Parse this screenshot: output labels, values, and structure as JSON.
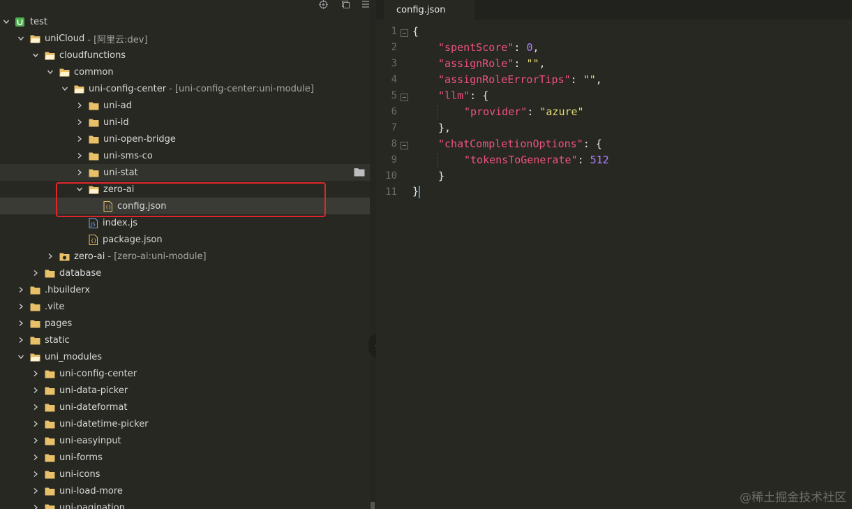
{
  "sidebar": {
    "toolbar": {
      "target_icon": "crosshair-icon",
      "collapse_icon": "collapse-all-icon",
      "menu_icon": "menu-icon"
    },
    "tree": [
      {
        "label": "test",
        "suffix": "",
        "depth": 0,
        "chevron": "down",
        "icon": "project-badge"
      },
      {
        "label": "uniCloud",
        "suffix": "[阿里云:dev]",
        "depth": 1,
        "chevron": "down",
        "icon": "folder-open"
      },
      {
        "label": "cloudfunctions",
        "suffix": "",
        "depth": 2,
        "chevron": "down",
        "icon": "folder-open"
      },
      {
        "label": "common",
        "suffix": "",
        "depth": 3,
        "chevron": "down",
        "icon": "folder-open"
      },
      {
        "label": "uni-config-center",
        "suffix": "[uni-config-center:uni-module]",
        "depth": 4,
        "chevron": "down",
        "icon": "folder-open"
      },
      {
        "label": "uni-ad",
        "suffix": "",
        "depth": 5,
        "chevron": "right",
        "icon": "folder"
      },
      {
        "label": "uni-id",
        "suffix": "",
        "depth": 5,
        "chevron": "right",
        "icon": "folder"
      },
      {
        "label": "uni-open-bridge",
        "suffix": "",
        "depth": 5,
        "chevron": "right",
        "icon": "folder"
      },
      {
        "label": "uni-sms-co",
        "suffix": "",
        "depth": 5,
        "chevron": "right",
        "icon": "folder"
      },
      {
        "label": "uni-stat",
        "suffix": "",
        "depth": 5,
        "chevron": "right",
        "icon": "folder"
      },
      {
        "label": "zero-ai",
        "suffix": "",
        "depth": 5,
        "chevron": "down",
        "icon": "folder-open"
      },
      {
        "label": "config.json",
        "suffix": "",
        "depth": 6,
        "chevron": "none",
        "icon": "json-file"
      },
      {
        "label": "index.js",
        "suffix": "",
        "depth": 5,
        "chevron": "none",
        "icon": "js-file"
      },
      {
        "label": "package.json",
        "suffix": "",
        "depth": 5,
        "chevron": "none",
        "icon": "json-file"
      },
      {
        "label": "zero-ai",
        "suffix": "[zero-ai:uni-module]",
        "depth": 3,
        "chevron": "right",
        "icon": "cloud-folder"
      },
      {
        "label": "database",
        "suffix": "",
        "depth": 2,
        "chevron": "right",
        "icon": "folder"
      },
      {
        "label": ".hbuilderx",
        "suffix": "",
        "depth": 1,
        "chevron": "right",
        "icon": "folder"
      },
      {
        "label": ".vite",
        "suffix": "",
        "depth": 1,
        "chevron": "right",
        "icon": "folder"
      },
      {
        "label": "pages",
        "suffix": "",
        "depth": 1,
        "chevron": "right",
        "icon": "folder"
      },
      {
        "label": "static",
        "suffix": "",
        "depth": 1,
        "chevron": "right",
        "icon": "folder"
      },
      {
        "label": "uni_modules",
        "suffix": "",
        "depth": 1,
        "chevron": "down",
        "icon": "folder-open"
      },
      {
        "label": "uni-config-center",
        "suffix": "",
        "depth": 2,
        "chevron": "right",
        "icon": "folder"
      },
      {
        "label": "uni-data-picker",
        "suffix": "",
        "depth": 2,
        "chevron": "right",
        "icon": "folder"
      },
      {
        "label": "uni-dateformat",
        "suffix": "",
        "depth": 2,
        "chevron": "right",
        "icon": "folder"
      },
      {
        "label": "uni-datetime-picker",
        "suffix": "",
        "depth": 2,
        "chevron": "right",
        "icon": "folder"
      },
      {
        "label": "uni-easyinput",
        "suffix": "",
        "depth": 2,
        "chevron": "right",
        "icon": "folder"
      },
      {
        "label": "uni-forms",
        "suffix": "",
        "depth": 2,
        "chevron": "right",
        "icon": "folder"
      },
      {
        "label": "uni-icons",
        "suffix": "",
        "depth": 2,
        "chevron": "right",
        "icon": "folder"
      },
      {
        "label": "uni-load-more",
        "suffix": "",
        "depth": 2,
        "chevron": "right",
        "icon": "folder"
      },
      {
        "label": "uni-pagination",
        "suffix": "",
        "depth": 2,
        "chevron": "right",
        "icon": "folder"
      }
    ],
    "hover_row": "uni-stat",
    "selected_row": "config.json",
    "highlighted_rows": [
      "zero-ai",
      "config.json"
    ]
  },
  "editor": {
    "tab_label": "config.json",
    "lines": [
      {
        "num": "1",
        "fold": true,
        "indent": 0,
        "tokens": [
          {
            "t": "{",
            "c": "p"
          }
        ]
      },
      {
        "num": "2",
        "fold": false,
        "indent": 1,
        "tokens": [
          {
            "t": "\"spentScore\"",
            "c": "k"
          },
          {
            "t": ": ",
            "c": "p"
          },
          {
            "t": "0",
            "c": "n"
          },
          {
            "t": ",",
            "c": "p"
          }
        ]
      },
      {
        "num": "3",
        "fold": false,
        "indent": 1,
        "tokens": [
          {
            "t": "\"assignRole\"",
            "c": "k"
          },
          {
            "t": ": ",
            "c": "p"
          },
          {
            "t": "\"\"",
            "c": "s"
          },
          {
            "t": ",",
            "c": "p"
          }
        ]
      },
      {
        "num": "4",
        "fold": false,
        "indent": 1,
        "tokens": [
          {
            "t": "\"assignRoleErrorTips\"",
            "c": "k"
          },
          {
            "t": ": ",
            "c": "p"
          },
          {
            "t": "\"\"",
            "c": "s"
          },
          {
            "t": ",",
            "c": "p"
          }
        ]
      },
      {
        "num": "5",
        "fold": true,
        "indent": 1,
        "tokens": [
          {
            "t": "\"llm\"",
            "c": "k"
          },
          {
            "t": ": {",
            "c": "p"
          }
        ]
      },
      {
        "num": "6",
        "fold": false,
        "indent": 2,
        "tokens": [
          {
            "t": "\"provider\"",
            "c": "k"
          },
          {
            "t": ": ",
            "c": "p"
          },
          {
            "t": "\"azure\"",
            "c": "s"
          }
        ]
      },
      {
        "num": "7",
        "fold": false,
        "indent": 1,
        "tokens": [
          {
            "t": "},",
            "c": "p"
          }
        ]
      },
      {
        "num": "8",
        "fold": true,
        "indent": 1,
        "tokens": [
          {
            "t": "\"chatCompletionOptions\"",
            "c": "k"
          },
          {
            "t": ": {",
            "c": "p"
          }
        ]
      },
      {
        "num": "9",
        "fold": false,
        "indent": 2,
        "tokens": [
          {
            "t": "\"tokensToGenerate\"",
            "c": "k"
          },
          {
            "t": ": ",
            "c": "p"
          },
          {
            "t": "512",
            "c": "n"
          }
        ]
      },
      {
        "num": "10",
        "fold": false,
        "indent": 1,
        "tokens": [
          {
            "t": "}",
            "c": "p"
          }
        ]
      },
      {
        "num": "11",
        "fold": false,
        "indent": 0,
        "tokens": [
          {
            "t": "}",
            "c": "p"
          }
        ],
        "cursor": true
      }
    ]
  },
  "watermark": "@稀土掘金技术社区",
  "colors": {
    "background": "#272822",
    "folder": "#e8c06a",
    "key": "#f0537c",
    "string": "#e6db74",
    "number": "#ae81ff",
    "highlight_border": "#e0262c",
    "cursor": "#3e8ed6",
    "project_badge": "#4cb050"
  }
}
